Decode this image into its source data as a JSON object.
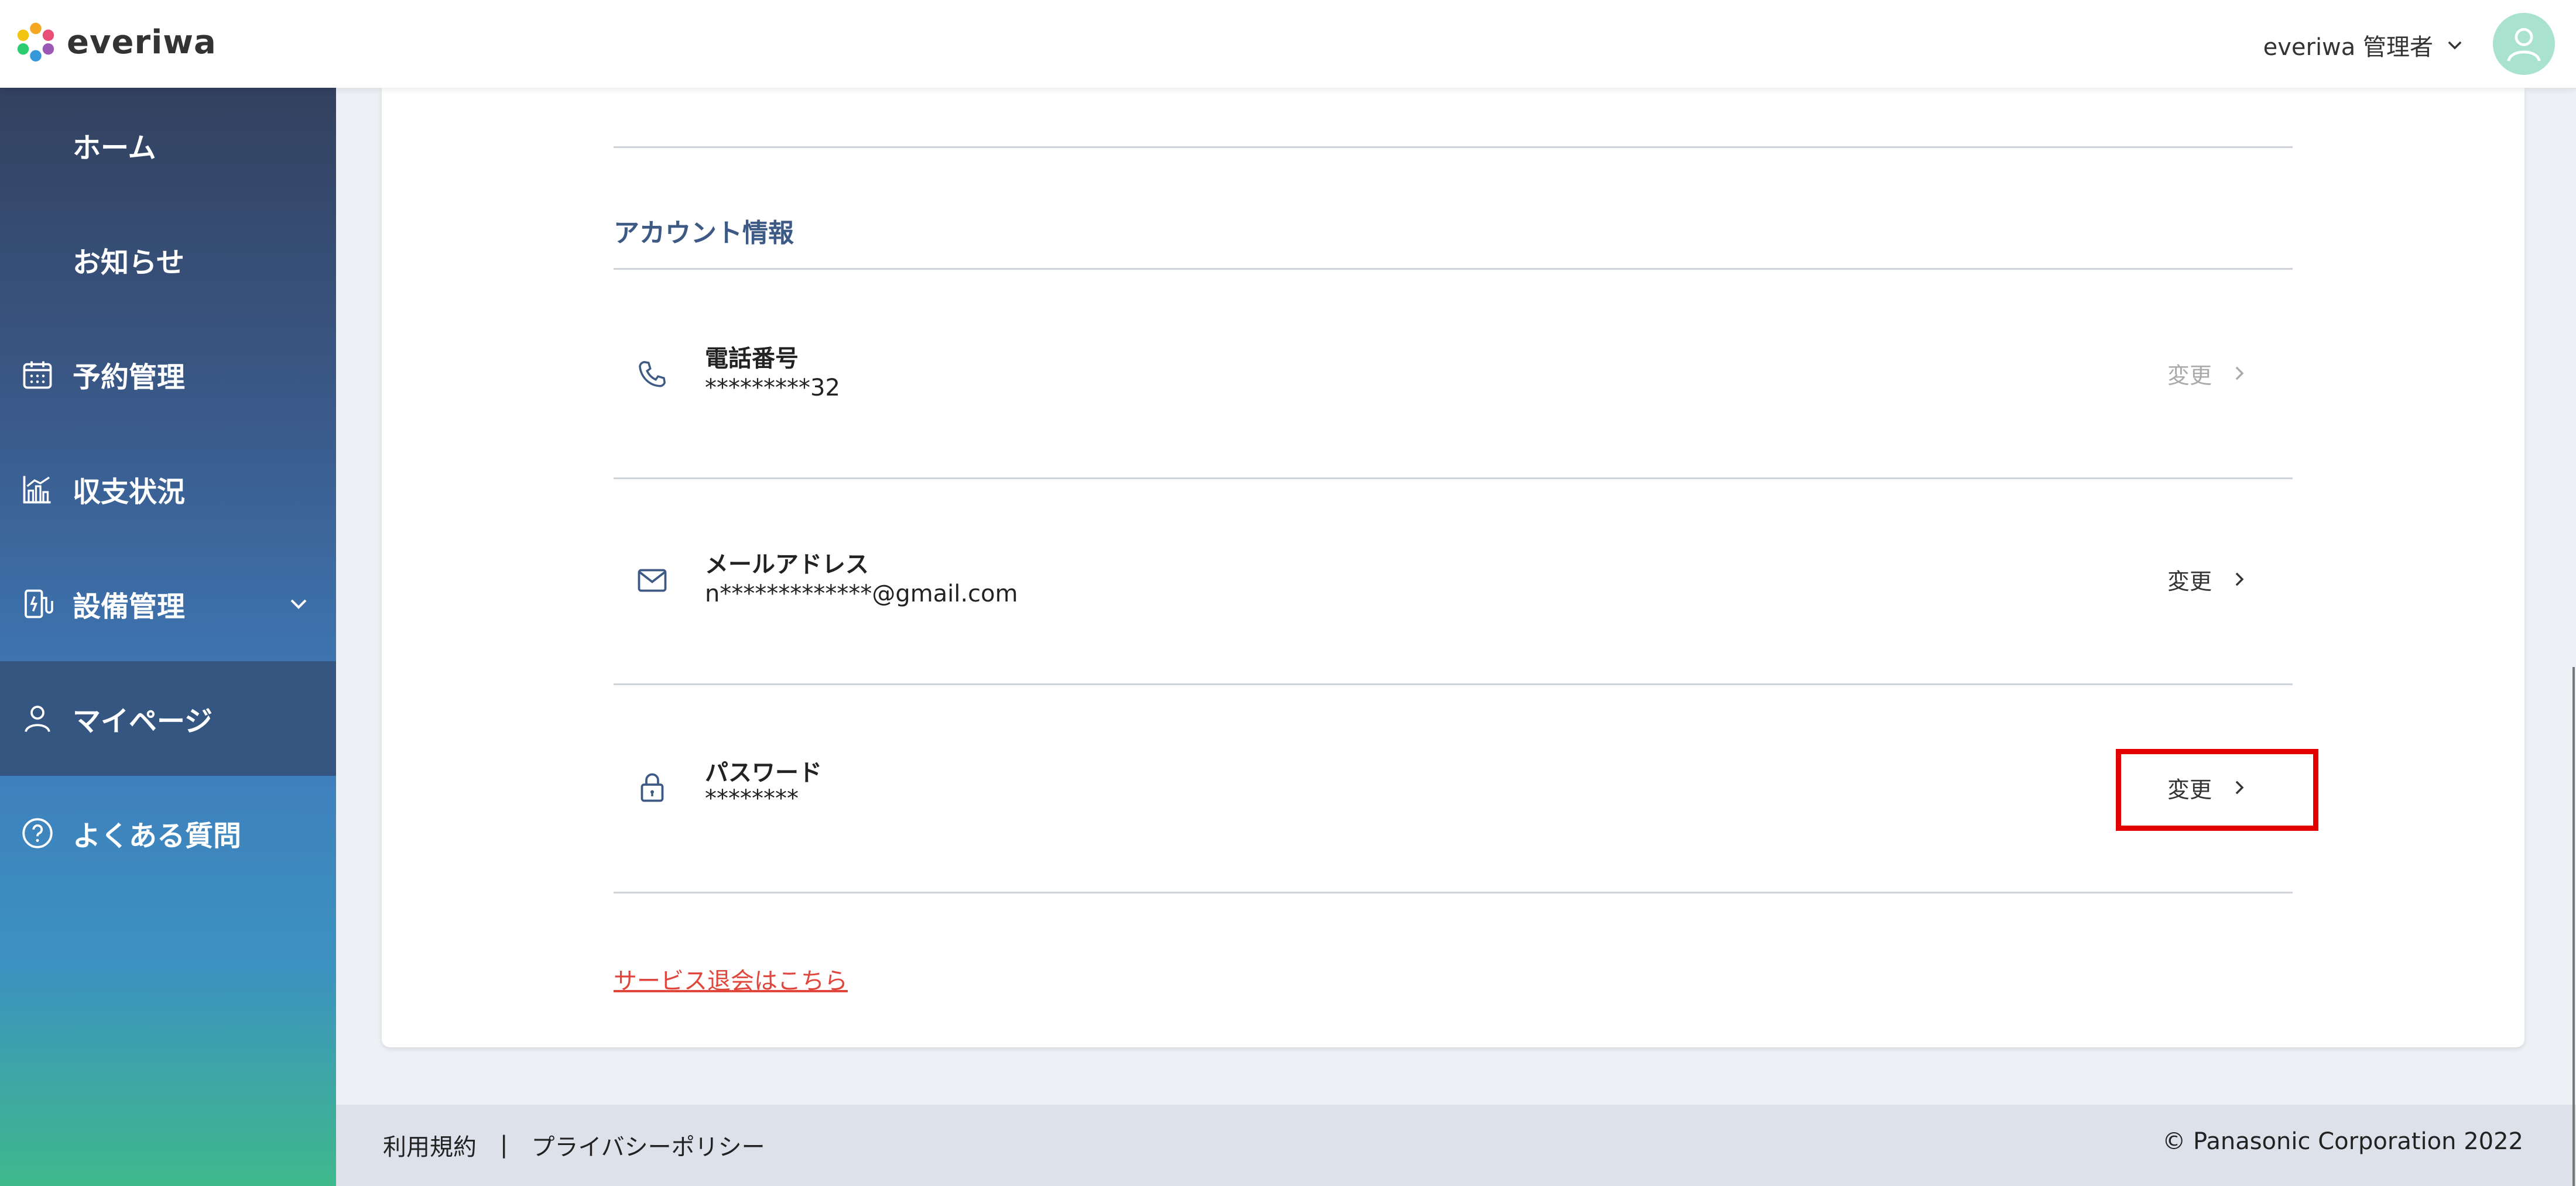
{
  "header": {
    "logo_text": "everiwa",
    "user_name": "everiwa 管理者"
  },
  "sidebar": {
    "items": [
      {
        "label": "ホーム",
        "icon": "none"
      },
      {
        "label": "お知らせ",
        "icon": "none"
      },
      {
        "label": "予約管理",
        "icon": "calendar-icon"
      },
      {
        "label": "収支状況",
        "icon": "chart-icon"
      },
      {
        "label": "設備管理",
        "icon": "charger-icon",
        "expandable": true
      },
      {
        "label": "マイページ",
        "icon": "user-icon",
        "active": true
      },
      {
        "label": "よくある質問",
        "icon": "question-icon"
      }
    ]
  },
  "account": {
    "section_title": "アカウント情報",
    "rows": [
      {
        "label": "電話番号",
        "value": "*********32",
        "action": "変更",
        "action_enabled": false,
        "icon": "phone-icon"
      },
      {
        "label": "メールアドレス",
        "value": "n*************@gmail.com",
        "action": "変更",
        "action_enabled": true,
        "icon": "mail-icon"
      },
      {
        "label": "パスワード",
        "value": "********",
        "action": "変更",
        "action_enabled": true,
        "icon": "lock-icon"
      }
    ],
    "withdraw_link": "サービス退会はこちら"
  },
  "footer": {
    "terms": "利用規約",
    "separator": "|",
    "privacy": "プライバシーポリシー",
    "copyright": "© Panasonic Corporation 2022"
  },
  "colors": {
    "accent_title": "#3d5a85",
    "withdraw_link": "#e0463c",
    "highlight": "#e30000"
  }
}
